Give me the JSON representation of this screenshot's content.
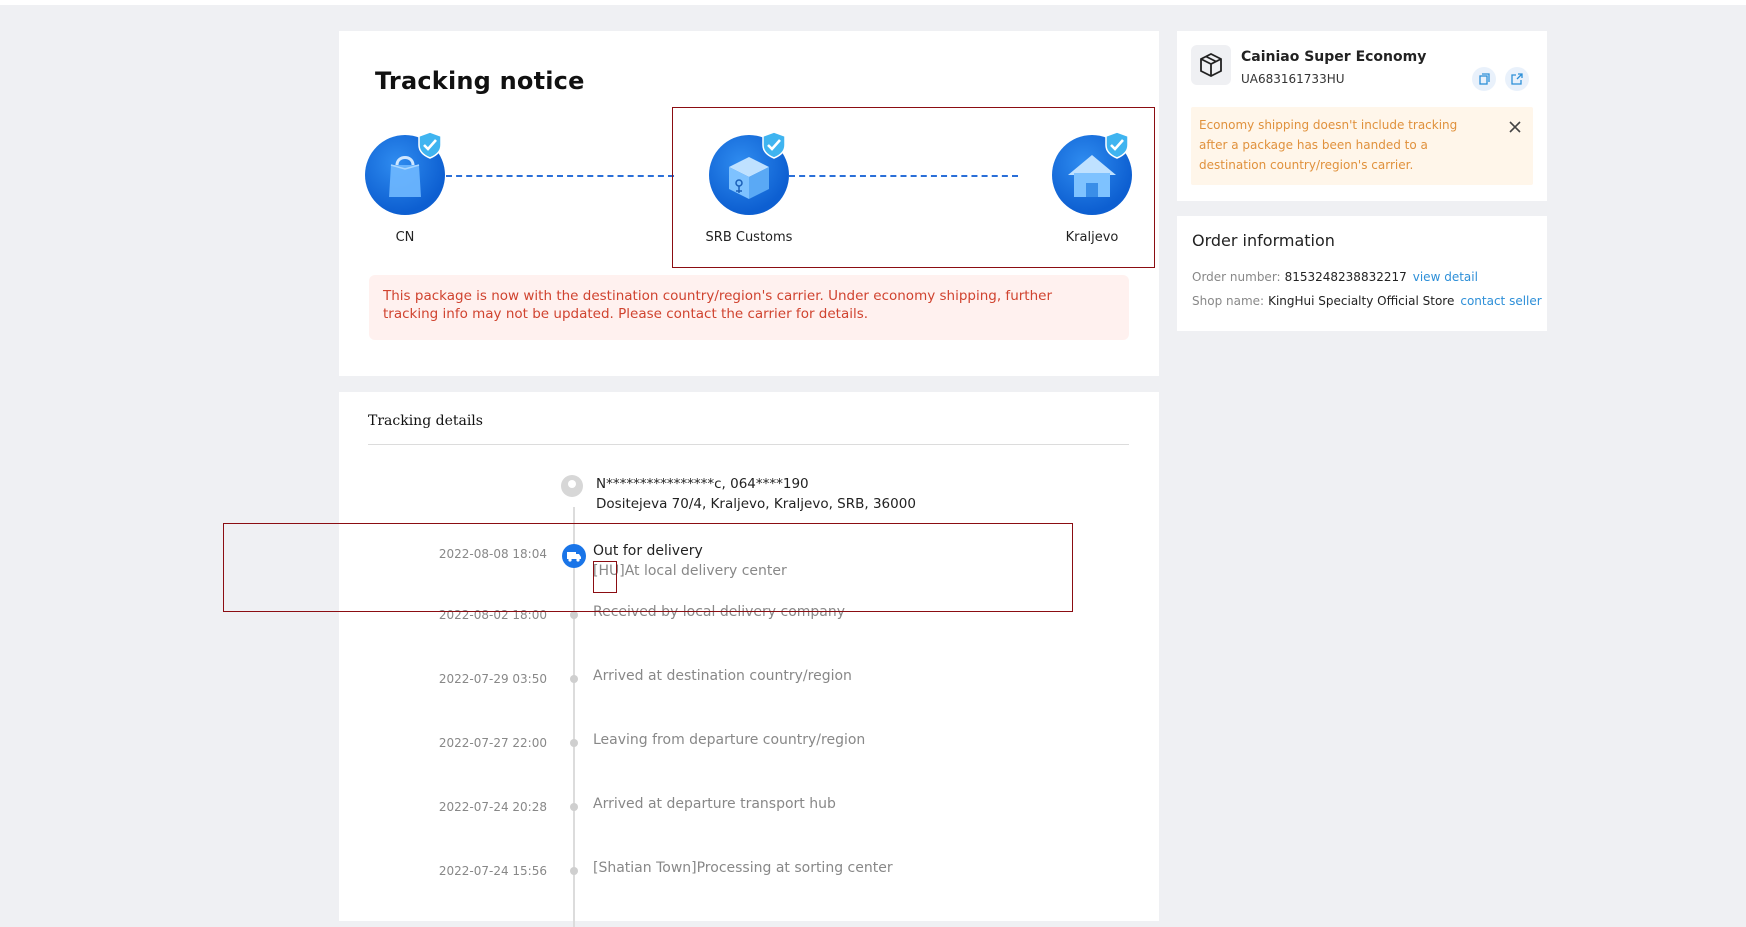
{
  "notice": {
    "title": "Tracking notice",
    "steps": [
      {
        "label": "CN",
        "icon": "shopping-bag-icon"
      },
      {
        "label": "SRB Customs",
        "icon": "customs-package-icon"
      },
      {
        "label": "Kraljevo",
        "icon": "house-icon"
      }
    ],
    "alert": "This package is now with the destination country/region's carrier. Under economy shipping, further tracking info may not be updated. Please contact the carrier for details."
  },
  "details": {
    "title": "Tracking details",
    "recipient_line": "N****************c,  064****190",
    "address_line": "Dositejeva 70/4,  Kraljevo,  Kraljevo,  SRB,  36000",
    "events": [
      {
        "date": "2022-08-08 18:04",
        "text": "Out for delivery",
        "sub": "[HU]At local delivery center",
        "active": true
      },
      {
        "date": "2022-08-02 18:00",
        "text": "Received by local delivery company"
      },
      {
        "date": "2022-07-29 03:50",
        "text": "Arrived at destination country/region"
      },
      {
        "date": "2022-07-27 22:00",
        "text": "Leaving from departure country/region"
      },
      {
        "date": "2022-07-24 20:28",
        "text": "Arrived at departure transport hub"
      },
      {
        "date": "2022-07-24 15:56",
        "text": "[Shatian Town]Processing at sorting center"
      }
    ]
  },
  "carrier": {
    "name": "Cainiao Super Economy",
    "tracking_number": "UA683161733HU",
    "warning": "Economy shipping doesn't include tracking after a package has been handed to a destination country/region's carrier."
  },
  "order": {
    "title": "Order information",
    "number_label": "Order number:",
    "number_value": "8153248238832217",
    "view_link": "view detail",
    "shop_label": "Shop name:",
    "shop_value": "KingHui Specialty Official Store",
    "contact_link": "contact seller"
  },
  "colors": {
    "accent": "#1a75e8",
    "alert_text": "#d0432f",
    "warning_text": "#e0913c",
    "link": "#2d8fd8",
    "annotation": "#8b0d12"
  }
}
